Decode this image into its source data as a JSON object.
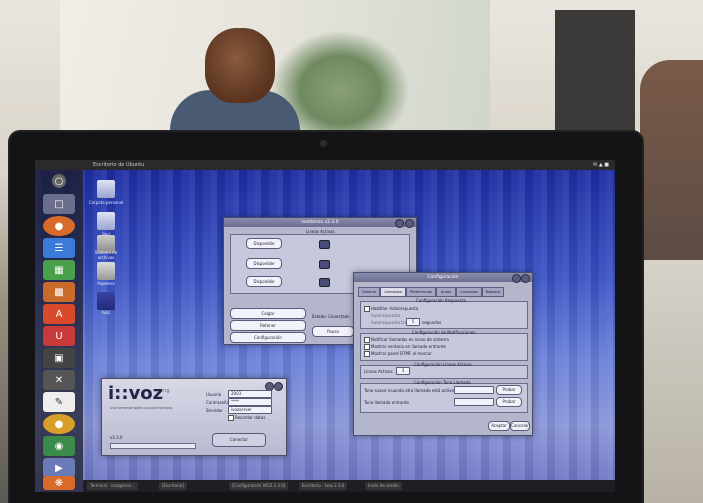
{
  "screen": {
    "topbar_title": "Escritorio de Ubuntu",
    "launcher_icons": [
      "home-icon",
      "files-icon",
      "firefox-icon",
      "writer-icon",
      "calc-icon",
      "impress-icon",
      "appcenter-icon",
      "ubuntu-one-icon",
      "workspace-icon",
      "settings-icon",
      "text-editor-icon",
      "system-icon",
      "network-icon",
      "photo-icon",
      "butterfly-icon"
    ],
    "desktop_icons": [
      {
        "label": "Carpeta personal"
      },
      {
        "label": "Red"
      },
      {
        "label": "Sistema de archivos"
      },
      {
        "label": "Papelera"
      },
      {
        "label": "Ivoz"
      }
    ],
    "taskbar": [
      "Terminal - ivoz@ivoz...",
      "[Escritorio]",
      "[Configuración IVOZ 2.3.0]",
      "Escritorio - Ivoz 2.3.0",
      "Inicio de sesión"
    ]
  },
  "status_window": {
    "title": "Ivoztones v2.3.0",
    "section": "Lineas Activas",
    "lines": [
      "Disponible",
      "Disponible",
      "Disponible"
    ],
    "buttons": [
      "Colgar",
      "Retener",
      "Configuración"
    ],
    "status_label": "Estado: Conectado",
    "pause_button": "Pausa"
  },
  "config_window": {
    "title": "Configuración",
    "tabs": [
      "General",
      "Llamadas",
      "Preferencias",
      "Audio",
      "Contactos",
      "Registro"
    ],
    "auto_answer": {
      "header": "Configuración Respuesta",
      "enable": "Habilitar Autorespuesta",
      "disable": "Autorespuesta",
      "delay_label": "Autorespuesta tras",
      "delay_value": "5",
      "delay_unit": "segundos"
    },
    "notifications": {
      "header": "Configuración de Notificaciones",
      "options": [
        "Notificar llamadas en icono de sistema",
        "Mostrar ventana en llamada entrante",
        "Mostrar panel DTMF al marcar"
      ]
    },
    "active_lines": {
      "header": "Configuración Líneas Activas",
      "label": "Líneas Activas",
      "value": "3"
    },
    "ringtones": {
      "header": "Configuración Tono Llamada",
      "items": [
        {
          "label": "Tono suave (cuando otra llamada está activa)",
          "button": "Probar"
        },
        {
          "label": "Tono llamada entrante",
          "button": "Probar"
        }
      ]
    },
    "ok_button": "Aceptar",
    "cancel_button": "Cancelar"
  },
  "login_window": {
    "logo": "i::voz",
    "logo_sup": "ng",
    "tagline": "IVOZ SOFTPHONE BASED ON IAX/SIP PROTOCOL",
    "fields": [
      {
        "label": "Usuario",
        "value": "2003"
      },
      {
        "label": "Contraseña",
        "value": "****"
      },
      {
        "label": "Servidor",
        "value": "ivozserver"
      }
    ],
    "remember": "Recordar datos",
    "version": "v2.3.0",
    "connect_button": "Conectar"
  },
  "colors": {
    "wallpaper": "#3a52c4",
    "window": "#b4b6cc",
    "titlebar": "#6c6e90"
  }
}
